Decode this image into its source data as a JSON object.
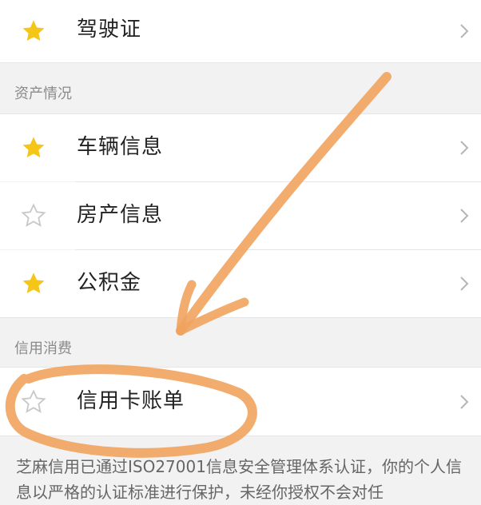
{
  "rows": {
    "driver_license": {
      "label": "驾驶证",
      "icon": "star-filled-icon"
    },
    "vehicle_info": {
      "label": "车辆信息",
      "icon": "star-filled-icon"
    },
    "property_info": {
      "label": "房产信息",
      "icon": "star-outline-icon"
    },
    "housing_fund": {
      "label": "公积金",
      "icon": "star-filled-icon"
    },
    "credit_card_bill": {
      "label": "信用卡账单",
      "icon": "star-outline-icon"
    }
  },
  "sections": {
    "assets": "资产情况",
    "credit": "信用消费"
  },
  "footer": {
    "text": "芝麻信用已通过ISO27001信息安全管理体系认证，你的个人信息以严格的认证标准进行保护，未经你授权不会对任"
  },
  "colors": {
    "star_filled": "#f5c518",
    "star_outline": "#c8c8c8",
    "chevron": "#b5b5b5",
    "annotation": "#f0a35e"
  }
}
